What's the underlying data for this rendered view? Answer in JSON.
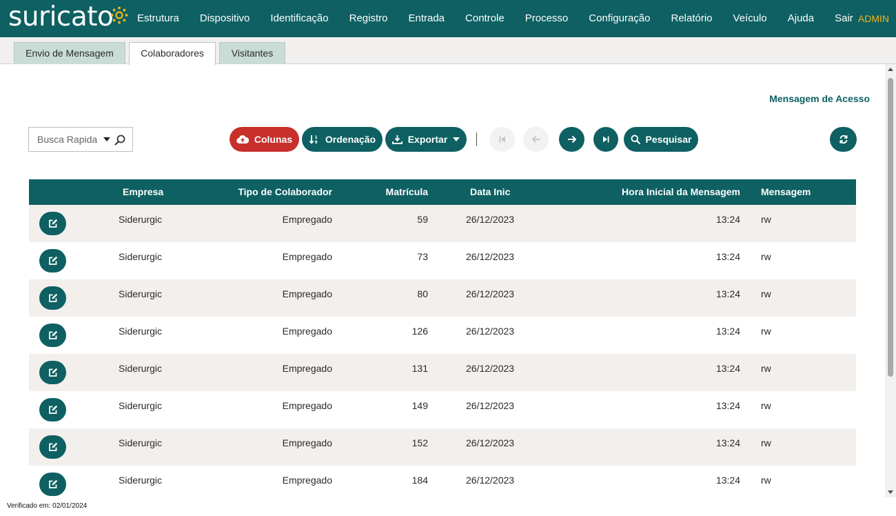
{
  "brand": {
    "logo_text": "suricato",
    "user": "ADMIN"
  },
  "nav": [
    "Estrutura",
    "Dispositivo",
    "Identificação",
    "Registro",
    "Entrada",
    "Controle",
    "Processo",
    "Configuração",
    "Relatório",
    "Veículo",
    "Ajuda",
    "Sair"
  ],
  "tabs": [
    {
      "label": "Envio de Mensagem",
      "active": false
    },
    {
      "label": "Colaboradores",
      "active": true
    },
    {
      "label": "Visitantes",
      "active": false
    }
  ],
  "page": {
    "title": "Mensagem de Acesso"
  },
  "search": {
    "placeholder": "Busca Rapida"
  },
  "toolbar": {
    "colunas": "Colunas",
    "ordenacao": "Ordenação",
    "exportar": "Exportar",
    "pesquisar": "Pesquisar"
  },
  "table": {
    "headers": {
      "empresa": "Empresa",
      "tipo": "Tipo de Colaborador",
      "matricula": "Matrícula",
      "data": "Data Inic",
      "hora": "Hora Inicial da Mensagem",
      "mensagem": "Mensagem"
    },
    "rows": [
      {
        "empresa": "Siderurgic",
        "tipo": "Empregado",
        "matricula": "59",
        "data": "26/12/2023",
        "hora": "13:24",
        "mensagem": "rw"
      },
      {
        "empresa": "Siderurgic",
        "tipo": "Empregado",
        "matricula": "73",
        "data": "26/12/2023",
        "hora": "13:24",
        "mensagem": "rw"
      },
      {
        "empresa": "Siderurgic",
        "tipo": "Empregado",
        "matricula": "80",
        "data": "26/12/2023",
        "hora": "13:24",
        "mensagem": "rw"
      },
      {
        "empresa": "Siderurgic",
        "tipo": "Empregado",
        "matricula": "126",
        "data": "26/12/2023",
        "hora": "13:24",
        "mensagem": "rw"
      },
      {
        "empresa": "Siderurgic",
        "tipo": "Empregado",
        "matricula": "131",
        "data": "26/12/2023",
        "hora": "13:24",
        "mensagem": "rw"
      },
      {
        "empresa": "Siderurgic",
        "tipo": "Empregado",
        "matricula": "149",
        "data": "26/12/2023",
        "hora": "13:24",
        "mensagem": "rw"
      },
      {
        "empresa": "Siderurgic",
        "tipo": "Empregado",
        "matricula": "152",
        "data": "26/12/2023",
        "hora": "13:24",
        "mensagem": "rw"
      },
      {
        "empresa": "Siderurgic",
        "tipo": "Empregado",
        "matricula": "184",
        "data": "26/12/2023",
        "hora": "13:24",
        "mensagem": "rw"
      }
    ]
  },
  "footer": {
    "verified": "Verificado em: 02/01/2024"
  },
  "colors": {
    "primary": "#0e6062",
    "danger": "#c8302c",
    "accent": "#f2b51c"
  }
}
